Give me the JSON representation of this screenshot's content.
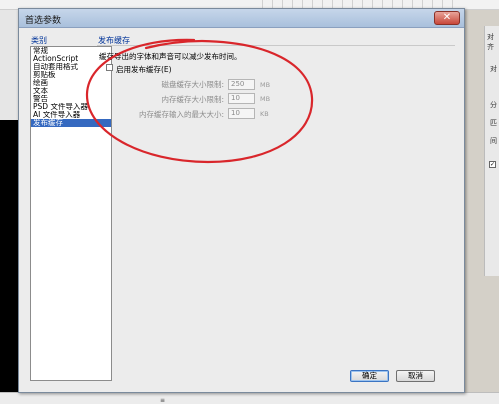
{
  "dialog": {
    "title": "首选参数",
    "close_glyph": "✕",
    "category_label": "类别",
    "categories": [
      "常规",
      "ActionScript",
      "自动套用格式",
      "剪贴板",
      "绘画",
      "文本",
      "警告",
      "PSD 文件导入器",
      "AI 文件导入器",
      "发布缓存"
    ],
    "selected_category_index": 9
  },
  "publish_cache": {
    "section_title": "发布缓存",
    "description": "缓存导出的字体和声音可以减少发布时间。",
    "enable_label": "启用发布缓存(E)",
    "enable_checked": false,
    "rows": [
      {
        "label": "磁盘缓存大小限制:",
        "value": "250",
        "unit": "MB"
      },
      {
        "label": "内存缓存大小限制:",
        "value": "10",
        "unit": "MB"
      },
      {
        "label": "内存缓存输入的最大大小:",
        "value": "10",
        "unit": "KB"
      }
    ]
  },
  "buttons": {
    "ok": "确定",
    "cancel": "取消"
  },
  "background": {
    "right_panel_title": "对齐",
    "right_panel_items": [
      "对",
      "分",
      "匹",
      "间"
    ],
    "bottom_mark": "≡"
  },
  "colors": {
    "annotation": "#d9262b",
    "selection": "#3569c0"
  }
}
